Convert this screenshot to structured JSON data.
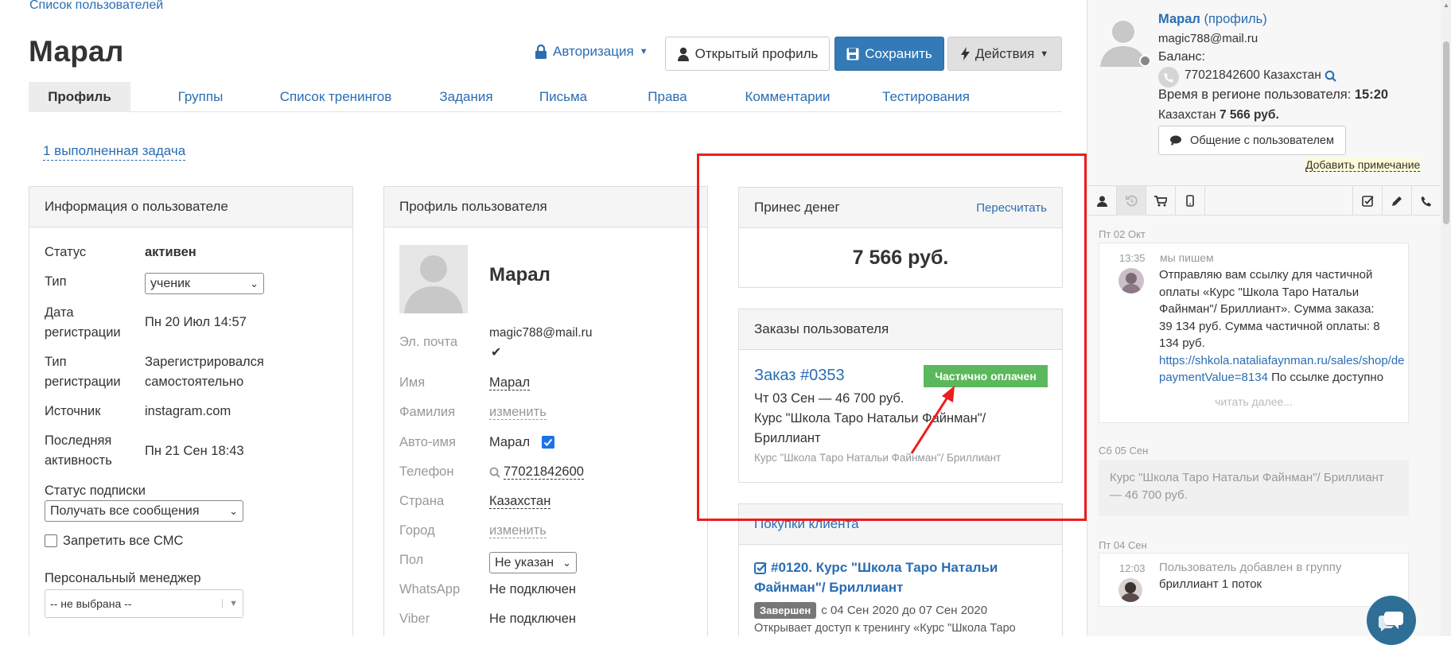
{
  "breadcrumb": "Список пользователей",
  "page_title": "Марал",
  "header_actions": {
    "auth": "Авторизация",
    "open_profile": "Открытый профиль",
    "save": "Сохранить",
    "actions": "Действия"
  },
  "tabs": [
    "Профиль",
    "Группы",
    "Список тренингов",
    "Задания",
    "Письма",
    "Права",
    "Комментарии",
    "Тестирования"
  ],
  "task_link": "1 выполненная задача",
  "user_info": {
    "title": "Информация о пользователе",
    "status_label": "Статус",
    "status_value": "активен",
    "type_label": "Тип",
    "type_value": "ученик",
    "reg_date_label_1": "Дата",
    "reg_date_label_2": "регистрации",
    "reg_date_value": "Пн 20 Июл 14:57",
    "reg_type_label_1": "Тип",
    "reg_type_label_2": "регистрации",
    "reg_type_value_1": "Зарегистрировался",
    "reg_type_value_2": "самостоятельно",
    "source_label": "Источник",
    "source_value": "instagram.com",
    "last_active_label_1": "Последняя",
    "last_active_label_2": "активность",
    "last_active_value": "Пн 21 Сен 18:43",
    "subscription_label": "Статус подписки",
    "subscription_value": "Получать все сообщения",
    "sms_label": "Запретить все СМС",
    "manager_label": "Персональный менеджер",
    "manager_value": "-- не выбрана --"
  },
  "profile": {
    "title": "Профиль пользователя",
    "name": "Марал",
    "email_label": "Эл. почта",
    "email_value": "magic788@mail.ru",
    "first_name_label": "Имя",
    "first_name_value": "Марал",
    "last_name_label": "Фамилия",
    "last_name_value": "изменить",
    "autoname_label": "Авто-имя",
    "autoname_value": "Марал",
    "phone_label": "Телефон",
    "phone_value": "77021842600",
    "country_label": "Страна",
    "country_value": "Казахстан",
    "city_label": "Город",
    "city_value": "изменить",
    "gender_label": "Пол",
    "gender_value": "Не указан",
    "whatsapp_label": "WhatsApp",
    "whatsapp_value": "Не подключен",
    "viber_label": "Viber",
    "viber_value": "Не подключен"
  },
  "money": {
    "title": "Принес денег",
    "recalc": "Пересчитать",
    "amount": "7 566 руб."
  },
  "orders": {
    "title": "Заказы пользователя",
    "order_link": "Заказ #0353",
    "status": "Частично оплачен",
    "date_sum": "Чт 03 Сен — 46 700 руб.",
    "course_1": "Курс \"Школа Таро Натальи Файнман\"/",
    "course_2": "Бриллиант",
    "course_small": "Курс \"Школа Таро Натальи Файнман\"/ Бриллиант"
  },
  "purchases": {
    "title": "Покупки клиента",
    "item_1": "#0120. Курс \"Школа Таро Натальи",
    "item_2": "Файнман\"/ Бриллиант",
    "badge": "Завершен",
    "period": "с 04 Сен 2020 до 07 Сен 2020",
    "desc": "Открывает доступ к тренингу «Курс \"Школа Таро"
  },
  "side": {
    "name": "Марал",
    "profile_link": "(профиль)",
    "email": "magic788@mail.ru",
    "balance_label": "Баланс:",
    "phone": "77021842600 Казахстан",
    "time_label": "Время в регионе пользователя:",
    "time_value": "15:20",
    "country": "Казахстан",
    "country_amount": "7 566 руб.",
    "chat_button": "Общение с пользователем",
    "add_note": "Добавить примечание",
    "day_1": "Пт 02 Окт",
    "msg_time": "13:35",
    "msg_author": "мы пишем",
    "msg_line_1": "Отправляю вам ссылку для частичной",
    "msg_line_2": "оплаты «Курс \"Школа Таро Натальи",
    "msg_line_3": "Файнман\"/ Бриллиант». Сумма заказа:",
    "msg_line_4": "39 134 руб. Сумма частичной оплаты: 8",
    "msg_line_5": "134 руб.",
    "msg_link_1": "https://shkola.nataliafaynman.ru/sales/shop/de",
    "msg_link_2": "paymentValue=8134",
    "msg_line_6": "По ссылке доступно",
    "read_more": "читать далее...",
    "day_2": "Сб 05 Сен",
    "order_note_1": "Курс \"Школа Таро Натальи Файнман\"/ Бриллиант",
    "order_note_2": "— 46 700 руб.",
    "day_3": "Пт 04 Сен",
    "event_time": "12:03",
    "event_line_1": "Пользователь добавлен в группу",
    "event_line_2": "бриллиант 1 поток"
  },
  "colors": {
    "accent": "#337ab7",
    "link": "#2a6db3",
    "highlight": "#ee1c1c",
    "paid_partial": "#5cb85c"
  }
}
